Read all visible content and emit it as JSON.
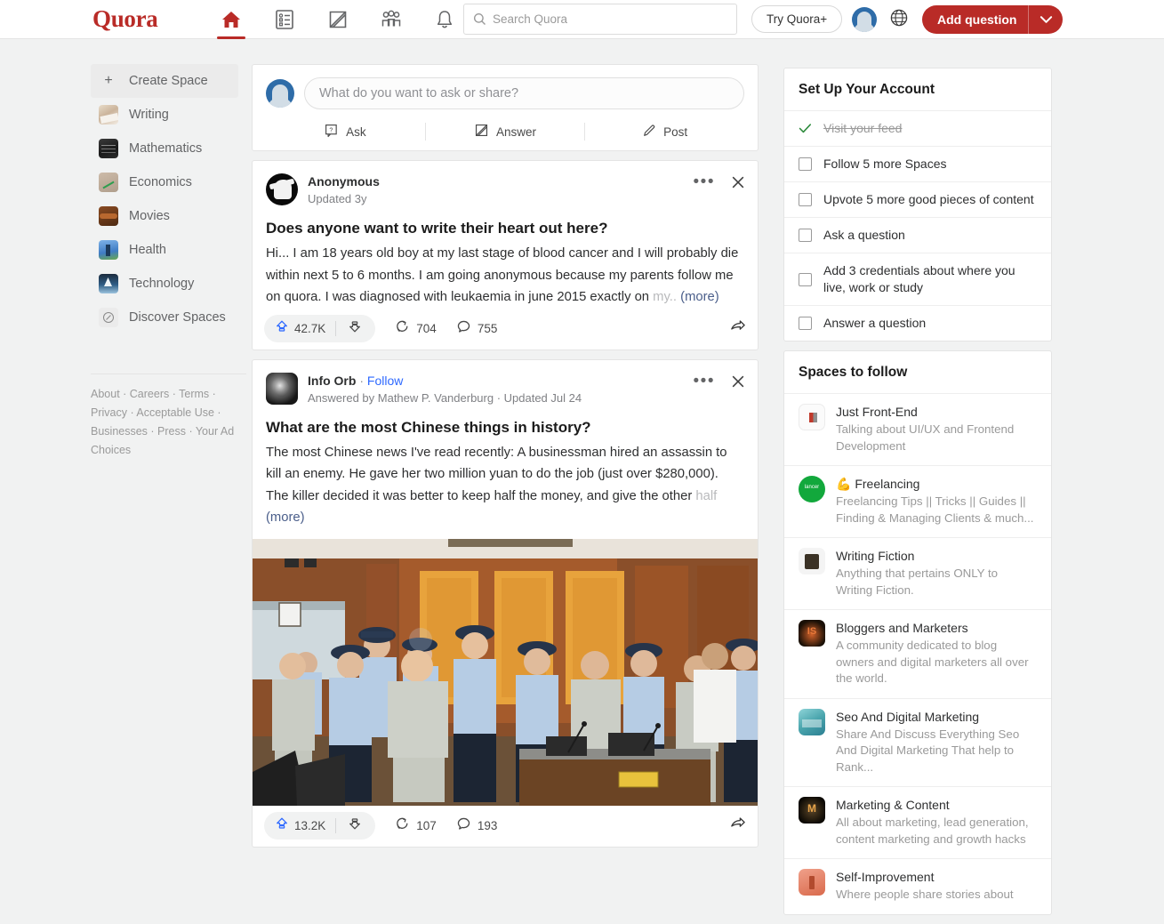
{
  "header": {
    "logo": "Quora",
    "nav": [
      {
        "name": "home-icon",
        "label": "Home",
        "active": true
      },
      {
        "name": "spaces-list-icon",
        "label": "Spaces",
        "active": false
      },
      {
        "name": "answer-pencil-icon",
        "label": "Answer",
        "active": false
      },
      {
        "name": "people-group-icon",
        "label": "Following",
        "active": false
      },
      {
        "name": "bell-icon",
        "label": "Notifications",
        "active": false
      }
    ],
    "search": {
      "placeholder": "Search Quora",
      "value": ""
    },
    "try_quora_plus": "Try Quora+",
    "add_question": "Add question",
    "brand_color": "#b92b27"
  },
  "sidebar": {
    "create_space": "Create Space",
    "items": [
      {
        "label": "Writing",
        "icon": "space-writing-icon"
      },
      {
        "label": "Mathematics",
        "icon": "space-mathematics-icon"
      },
      {
        "label": "Economics",
        "icon": "space-economics-icon"
      },
      {
        "label": "Movies",
        "icon": "space-movies-icon"
      },
      {
        "label": "Health",
        "icon": "space-health-icon"
      },
      {
        "label": "Technology",
        "icon": "space-technology-icon"
      },
      {
        "label": "Discover Spaces",
        "icon": "compass-icon"
      }
    ],
    "footer_links": [
      "About",
      "Careers",
      "Terms",
      "Privacy",
      "Acceptable Use",
      "Businesses",
      "Press",
      "Your Ad Choices"
    ],
    "footer_text": "About · Careers · Terms · Privacy · Acceptable Use · Businesses · Press · Your Ad Choices"
  },
  "compose": {
    "placeholder": "What do you want to ask or share?",
    "actions": [
      {
        "label": "Ask",
        "icon": "question-box-icon"
      },
      {
        "label": "Answer",
        "icon": "answer-pencil-icon"
      },
      {
        "label": "Post",
        "icon": "pencil-icon"
      }
    ]
  },
  "posts": [
    {
      "author": "Anonymous",
      "author_suffix": "",
      "follow_label": "",
      "subtitle": "Updated 3y",
      "title": "Does anyone want to write their heart out here?",
      "body": "Hi... I am 18 years old boy at my last stage of blood cancer and I will probably die within next 5 to 6 months. I am going anonymous because my parents follow me on quora. I was diagnosed with leukaemia in june 2015 exactly on ",
      "body_fade": "my..",
      "more_label": "(more)",
      "upvotes": "42.7K",
      "reshares": "704",
      "comments": "755",
      "has_image": false
    },
    {
      "author": "Info Orb",
      "author_suffix": "·",
      "follow_label": "Follow",
      "subtitle": "Answered by Mathew P. Vanderburg  · Updated Jul 24",
      "title": "What are the most Chinese things in history?",
      "body": "The most Chinese news I've read recently: A businessman hired an assassin to kill an enemy. He gave her two million yuan to do the job (just over $280,000). The killer decided it was better to keep half the money, and give the other ",
      "body_fade": "half",
      "more_label": "(more)",
      "upvotes": "13.2K",
      "reshares": "107",
      "comments": "193",
      "has_image": true,
      "image_alt": "Group of men in grey prison uniforms standing with uniformed police officers in a Chinese courtroom"
    }
  ],
  "setup_panel": {
    "title": "Set Up Your Account",
    "items": [
      {
        "label": "Visit your feed",
        "done": true
      },
      {
        "label": "Follow 5 more Spaces",
        "done": false
      },
      {
        "label": "Upvote 5 more good pieces of content",
        "done": false
      },
      {
        "label": "Ask a question",
        "done": false
      },
      {
        "label": "Add 3 credentials about where you live, work or study",
        "done": false
      },
      {
        "label": "Answer a question",
        "done": false
      }
    ]
  },
  "spaces_panel": {
    "title": "Spaces to follow",
    "items": [
      {
        "name": "Just Front-End",
        "desc": "Talking about UI/UX and Frontend Development",
        "avatar": "a-frontend"
      },
      {
        "name": "💪 Freelancing",
        "desc": "Freelancing Tips || Tricks || Guides || Finding & Managing Clients & much...",
        "avatar": "a-freelance"
      },
      {
        "name": "Writing Fiction",
        "desc": "Anything that pertains ONLY to Writing Fiction.",
        "avatar": "a-writingf"
      },
      {
        "name": "Bloggers and Marketers",
        "desc": "A community dedicated to blog owners and digital marketers all over the world.",
        "avatar": "a-bloggers"
      },
      {
        "name": "Seo And Digital Marketing",
        "desc": "Share And Discuss Everything Seo And Digital Marketing That help to Rank...",
        "avatar": "a-seo"
      },
      {
        "name": "Marketing & Content",
        "desc": "All about marketing, lead generation, content marketing and growth hacks",
        "avatar": "a-marketing"
      },
      {
        "name": "Self-Improvement",
        "desc": "Where people share stories about",
        "avatar": "a-selfimp"
      }
    ]
  }
}
